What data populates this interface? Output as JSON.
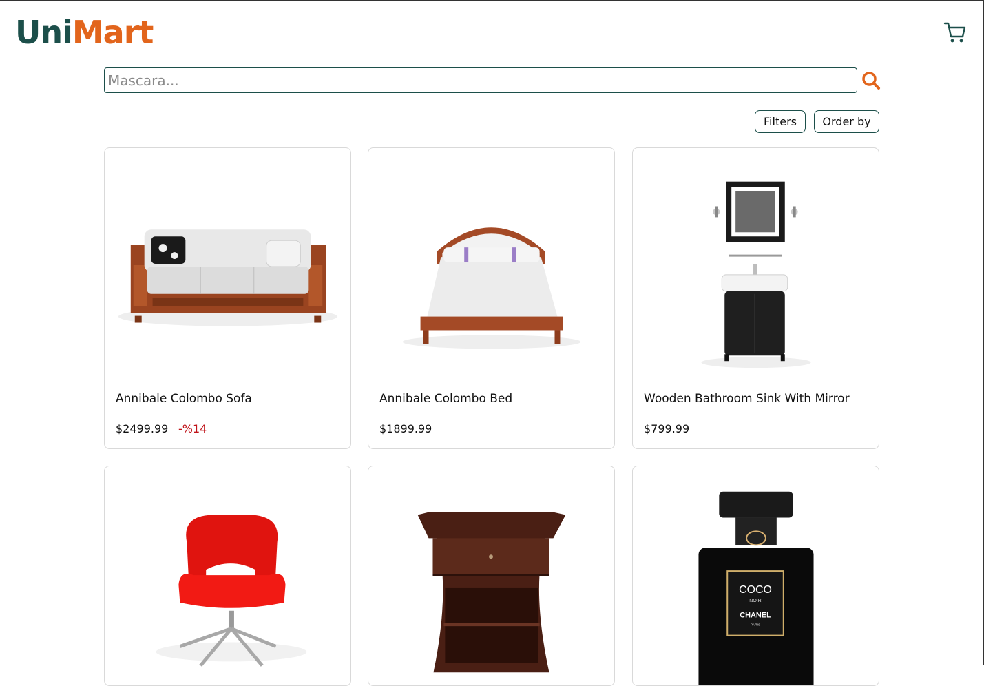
{
  "brand": {
    "part1": "Uni",
    "part2": "Mart",
    "primary_color": "#1c4f4a",
    "accent_color": "#e2651c"
  },
  "header": {
    "cart_icon": "shopping-cart-icon"
  },
  "search": {
    "placeholder": "Mascara...",
    "value": "",
    "icon": "search-icon"
  },
  "toolbar": {
    "filters_label": "Filters",
    "order_by_label": "Order by"
  },
  "products": [
    {
      "name": "Annibale Colombo Sofa",
      "price": "$2499.99",
      "discount": "-%14",
      "image_icon": "sofa-image"
    },
    {
      "name": "Annibale Colombo Bed",
      "price": "$1899.99",
      "image_icon": "bed-image"
    },
    {
      "name": "Wooden Bathroom Sink With Mirror",
      "price": "$799.99",
      "image_icon": "bathroom-sink-image"
    },
    {
      "name": "",
      "price": "",
      "image_icon": "red-office-chair-image"
    },
    {
      "name": "",
      "price": "",
      "image_icon": "nightstand-image"
    },
    {
      "name": "",
      "price": "",
      "image_icon": "perfume-bottle-image",
      "image_text": [
        "COCO",
        "NOIR",
        "CHANEL",
        "PARIS"
      ]
    }
  ]
}
